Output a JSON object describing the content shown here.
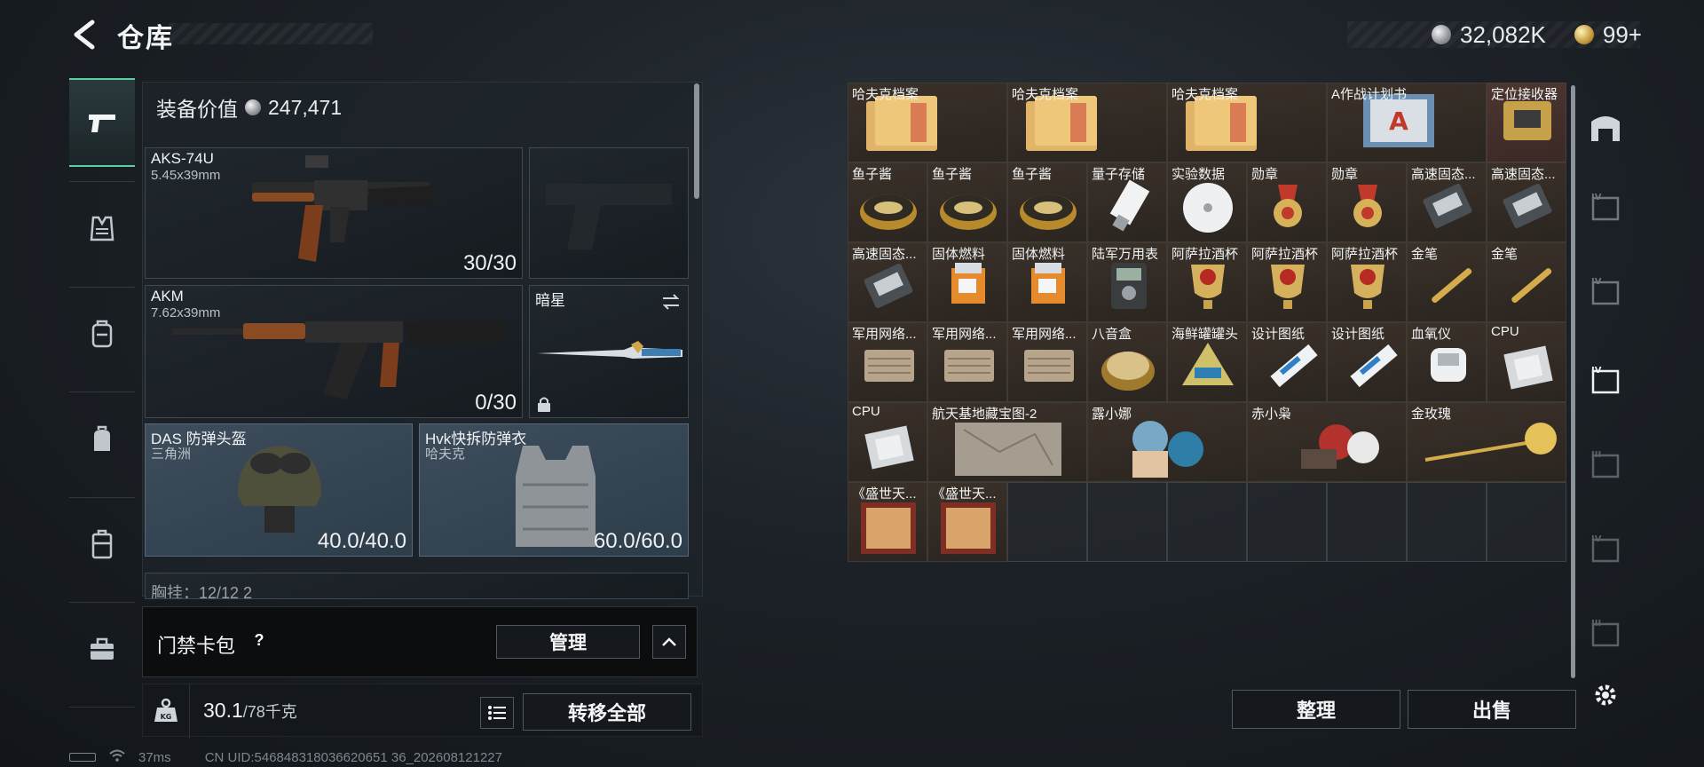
{
  "header": {
    "title": "仓库",
    "currency1": "32,082K",
    "currency2": "99+"
  },
  "left_rail": {
    "items": [
      "pistol-icon",
      "vest-icon",
      "backpack-icon",
      "bag-icon",
      "case-icon",
      "toolbox-icon"
    ]
  },
  "equipment": {
    "value_label": "装备价值",
    "value": "247,471",
    "slots": [
      {
        "name": "AKS-74U",
        "sub": "5.45x39mm",
        "count": "30/30"
      },
      {
        "name": "",
        "sub": "",
        "count": ""
      },
      {
        "name": "AKM",
        "sub": "7.62x39mm",
        "count": "0/30"
      },
      {
        "name": "暗星",
        "sub": "",
        "count": ""
      },
      {
        "name": "DAS 防弹头盔",
        "sub": "三角洲",
        "count": "40.0/40.0"
      },
      {
        "name": "Hvk快拆防弹衣",
        "sub": "哈夫克",
        "count": "60.0/60.0"
      }
    ],
    "partial_label": "胸挂：12/12  2"
  },
  "keycard": {
    "label": "门禁卡包",
    "help": "?",
    "manage": "管理"
  },
  "weight": {
    "current": "30.1",
    "max": "/78千克",
    "transfer_all": "转移全部"
  },
  "status": {
    "ping": "37ms",
    "uid": "CN UID:546848318036620651 36_202608121227"
  },
  "stash": {
    "items": [
      {
        "label": "哈夫克档案",
        "art": "doc"
      },
      {
        "label": "哈夫克档案",
        "art": "doc"
      },
      {
        "label": "哈夫克档案",
        "art": "doc"
      },
      {
        "label": "A作战计划书",
        "art": "plan"
      },
      {
        "label": "定位接收器",
        "art": "receiver"
      },
      {
        "label": "鱼子酱",
        "art": "caviar"
      },
      {
        "label": "鱼子酱",
        "art": "caviar"
      },
      {
        "label": "鱼子酱",
        "art": "caviar"
      },
      {
        "label": "量子存储",
        "art": "usb"
      },
      {
        "label": "实验数据",
        "art": "disc"
      },
      {
        "label": "勋章",
        "art": "medal"
      },
      {
        "label": "勋章",
        "art": "medal"
      },
      {
        "label": "高速固态...",
        "art": "ssd"
      },
      {
        "label": "高速固态...",
        "art": "ssd"
      },
      {
        "label": "高速固态...",
        "art": "ssd"
      },
      {
        "label": "固体燃料",
        "art": "fuel"
      },
      {
        "label": "固体燃料",
        "art": "fuel"
      },
      {
        "label": "陆军万用表",
        "art": "meter"
      },
      {
        "label": "阿萨拉酒杯",
        "art": "cup"
      },
      {
        "label": "阿萨拉酒杯",
        "art": "cup"
      },
      {
        "label": "阿萨拉酒杯",
        "art": "cup"
      },
      {
        "label": "金笔",
        "art": "pen"
      },
      {
        "label": "金笔",
        "art": "pen"
      },
      {
        "label": "军用网络...",
        "art": "net"
      },
      {
        "label": "军用网络...",
        "art": "net"
      },
      {
        "label": "军用网络...",
        "art": "net"
      },
      {
        "label": "八音盒",
        "art": "musicbox"
      },
      {
        "label": "海鲜罐罐头",
        "art": "can"
      },
      {
        "label": "设计图纸",
        "art": "blueprint"
      },
      {
        "label": "设计图纸",
        "art": "blueprint"
      },
      {
        "label": "血氧仪",
        "art": "oximeter"
      },
      {
        "label": "CPU",
        "art": "cpu"
      },
      {
        "label": "CPU",
        "art": "cpu"
      },
      {
        "label": "航天基地藏宝图-2",
        "art": "map"
      },
      {
        "label": "露小娜",
        "art": "doll"
      },
      {
        "label": "赤小枭",
        "art": "doll2"
      },
      {
        "label": "金玫瑰",
        "art": "rose"
      },
      {
        "label": "《盛世天...",
        "art": "book"
      },
      {
        "label": "《盛世天...",
        "art": "book"
      }
    ],
    "sort": "整理",
    "sell": "出售"
  },
  "right_rail": {
    "items": [
      "ceiling-icon",
      "tier-iv-cabinet-icon",
      "tier-iv-cabinet-icon-2",
      "tier-iv-cabinet-active-icon",
      "tier-iii-cabinet-icon",
      "tier-iv-cabinet-icon-3",
      "tier-iii-cabinet-icon-2"
    ],
    "settings": "gear-icon"
  }
}
